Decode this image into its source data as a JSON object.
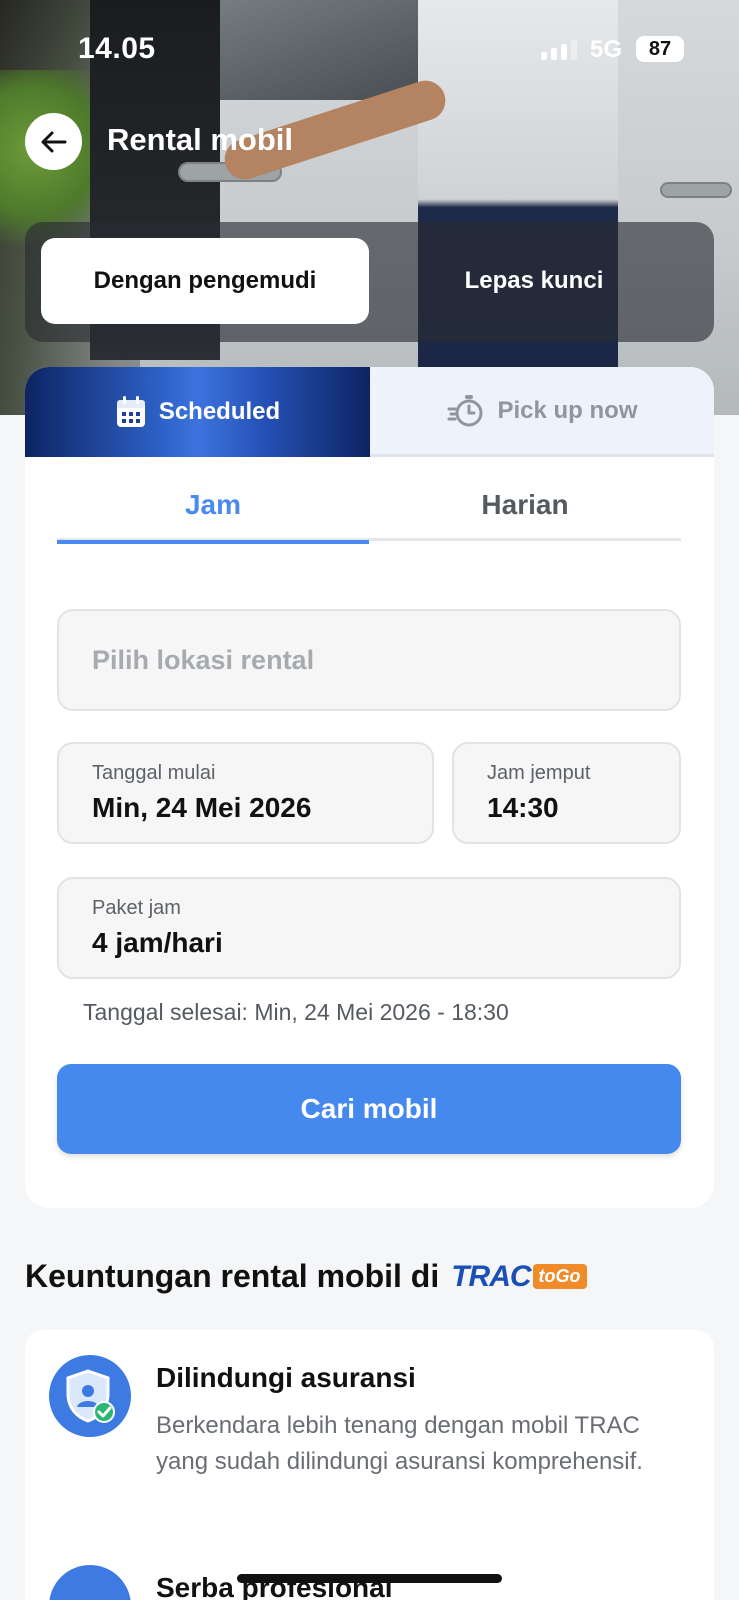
{
  "status_bar": {
    "time": "14.05",
    "network": "5G",
    "battery": "87"
  },
  "header": {
    "title": "Rental mobil"
  },
  "driver_toggle": {
    "with_driver": "Dengan pengemudi",
    "self_drive": "Lepas kunci",
    "selected": "Dengan pengemudi"
  },
  "mode_tabs": {
    "scheduled": "Scheduled",
    "pickup_now": "Pick up now",
    "selected": "Scheduled"
  },
  "sub_tabs": {
    "hourly": "Jam",
    "daily": "Harian",
    "selected": "Jam"
  },
  "form": {
    "location_placeholder": "Pilih lokasi rental",
    "start_date_label": "Tanggal mulai",
    "start_date_value": "Min, 24 Mei 2026",
    "pickup_time_label": "Jam jemput",
    "pickup_time_value": "14:30",
    "package_label": "Paket jam",
    "package_value": "4 jam/hari",
    "end_date_text": "Tanggal selesai: Min, 24 Mei 2026 - 18:30",
    "search_button": "Cari mobil"
  },
  "benefits": {
    "heading": "Keuntungan rental mobil di",
    "logo_main": "TRAC",
    "logo_sub": "toGo",
    "items": [
      {
        "title": "Dilindungi asuransi",
        "desc": "Berkendara lebih tenang dengan mobil TRAC yang sudah dilindungi asuransi komprehensif.",
        "icon": "shield-user-icon"
      },
      {
        "title": "Serba profesional",
        "icon": "benefit-icon"
      }
    ]
  },
  "colors": {
    "accent": "#4589ee",
    "brand_dark": "#0d2463",
    "brand_orange": "#f08b2a"
  }
}
